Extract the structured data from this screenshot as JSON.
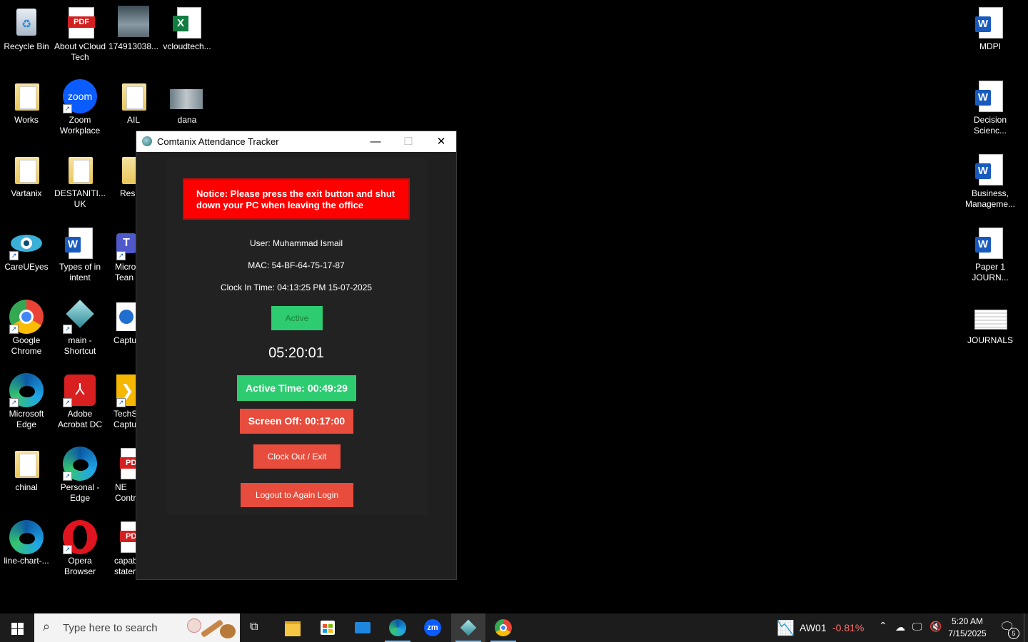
{
  "desktop": {
    "left_icons": [
      {
        "label": "Recycle Bin"
      },
      {
        "label": "About vCloud Tech"
      },
      {
        "label": "174913038..."
      },
      {
        "label": "vcloudtech..."
      },
      {
        "label": "Works"
      },
      {
        "label": "Zoom Workplace"
      },
      {
        "label": "AIL"
      },
      {
        "label": "dana"
      },
      {
        "label": "Vartanix"
      },
      {
        "label": "DESTANITI... UK"
      },
      {
        "label": "Resu"
      },
      {
        "label": "CareUEyes"
      },
      {
        "label": "Types of in intent"
      },
      {
        "label": "Micro Tean"
      },
      {
        "label": "Google Chrome"
      },
      {
        "label": "main - Shortcut"
      },
      {
        "label": "Captu"
      },
      {
        "label": "Microsoft Edge"
      },
      {
        "label": "Adobe Acrobat DC"
      },
      {
        "label": "TechS Captu"
      },
      {
        "label": "chinal"
      },
      {
        "label": "Personal - Edge"
      },
      {
        "label": "NE Contr"
      },
      {
        "label": "line-chart-..."
      },
      {
        "label": "Opera Browser"
      },
      {
        "label": "capab stater"
      }
    ],
    "right_icons": [
      {
        "label": "MDPI"
      },
      {
        "label": "Decision Scienc..."
      },
      {
        "label": "Business, Manageme..."
      },
      {
        "label": "Paper 1 JOURN..."
      },
      {
        "label": "JOURNALS"
      }
    ]
  },
  "window": {
    "title": "Comtanix Attendance Tracker",
    "notice": "Notice: Please press the exit button and shut down your PC when leaving the office",
    "user": "User: Muhammad Ismail",
    "mac": "MAC: 54-BF-64-75-17-87",
    "clock_in": "Clock In Time: 04:13:25 PM 15-07-2025",
    "status": "Active",
    "timer": "05:20:01",
    "active_time": "Active Time: 00:49:29",
    "screen_off": "Screen Off: 00:17:00",
    "clock_out": "Clock Out / Exit",
    "logout": "Logout to Again Login"
  },
  "taskbar": {
    "search_placeholder": "Type here to search",
    "stock_name": "AW01",
    "stock_change": "-0.81%",
    "time": "5:20 AM",
    "date": "7/15/2025",
    "notification_count": "5"
  },
  "colors": {
    "notice_red": "#ff0000",
    "green": "#2ecc71",
    "red": "#e74c3c",
    "stock_negative": "#ff6b6b"
  }
}
